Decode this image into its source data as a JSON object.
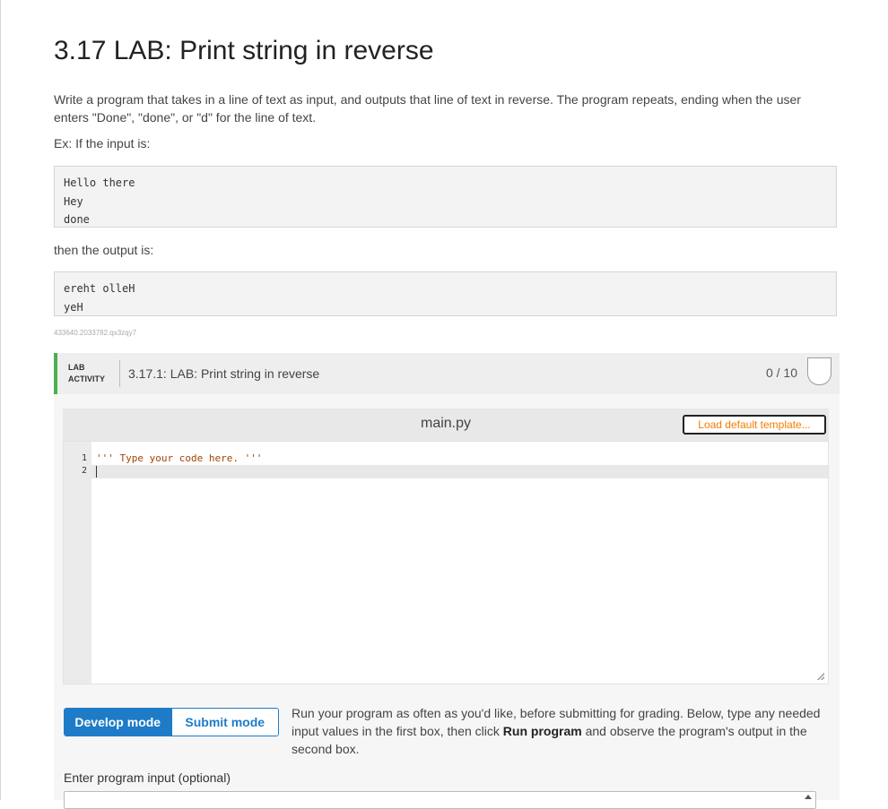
{
  "page": {
    "title": "3.17 LAB: Print string in reverse",
    "description": "Write a program that takes in a line of text as input, and outputs that line of text in reverse. The program repeats, ending when the user enters \"Done\", \"done\", or \"d\" for the line of text.",
    "example_intro": "Ex: If the input is:",
    "example_input": [
      "Hello there",
      "Hey",
      "done"
    ],
    "output_intro": "then the output is:",
    "example_output": [
      "ereht olleH",
      "yeH"
    ],
    "identifier": "433640.2033782.qx3zqy7"
  },
  "lab": {
    "tag_line1": "LAB",
    "tag_line2": "ACTIVITY",
    "title": "3.17.1: LAB: Print string in reverse",
    "score": "0 / 10"
  },
  "editor": {
    "filename": "main.py",
    "load_template_label": "Load default template...",
    "line_numbers": [
      "1",
      "2"
    ],
    "code_lines": [
      "''' Type your code here. '''",
      ""
    ]
  },
  "modes": {
    "develop_label": "Develop mode",
    "submit_label": "Submit mode",
    "description_pre": "Run your program as often as you'd like, before submitting for grading. Below, type any needed input values in the first box, then click ",
    "description_bold": "Run program",
    "description_post": " and observe the program's output in the second box."
  },
  "input": {
    "label": "Enter program input (optional)",
    "value": ""
  },
  "colors": {
    "accent_blue": "#1e7bc7",
    "lab_green": "#4caf50",
    "template_orange": "#f57c00",
    "code_comment": "#a24400"
  }
}
